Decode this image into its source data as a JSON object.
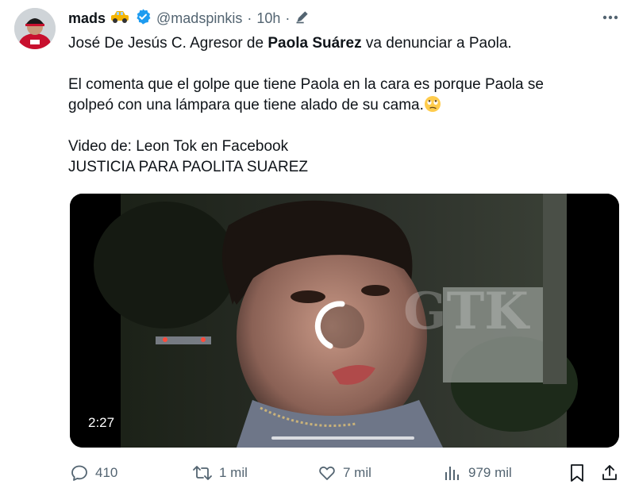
{
  "tweet": {
    "display_name": "mads",
    "name_emoji": "car-emoji",
    "verified_icon": "verified-badge-icon",
    "handle": "@madspinkis",
    "separator": "·",
    "time": "10h",
    "edited_icon": "pencil-edit-icon",
    "more_icon": "more-dots-icon",
    "text": {
      "line1_prefix": "José De Jesús C. Agresor de ",
      "line1_bold": "Paola Suárez",
      "line1_suffix": " va denunciar a Paola.",
      "para2_line1": "El comenta que el golpe que tiene Paola en la cara es porque Paola se",
      "para2_line2": "golpeó con una lámpara que tiene alado de su cama.",
      "para2_emoji": "face-with-rolling-eyes-emoji",
      "para3_line1": "Video de: Leon Tok en Facebook",
      "para3_line2": "JUSTICIA PARA PAOLITA SUAREZ"
    },
    "video": {
      "duration": "2:27",
      "watermark": "GTK",
      "loading": true
    },
    "actions": {
      "replies": "410",
      "reposts": "1 mil",
      "likes": "7 mil",
      "views": "979 mil"
    },
    "colors": {
      "verified": "#1d9bf0",
      "secondary_text": "#536471",
      "primary_text": "#0f1419"
    }
  }
}
